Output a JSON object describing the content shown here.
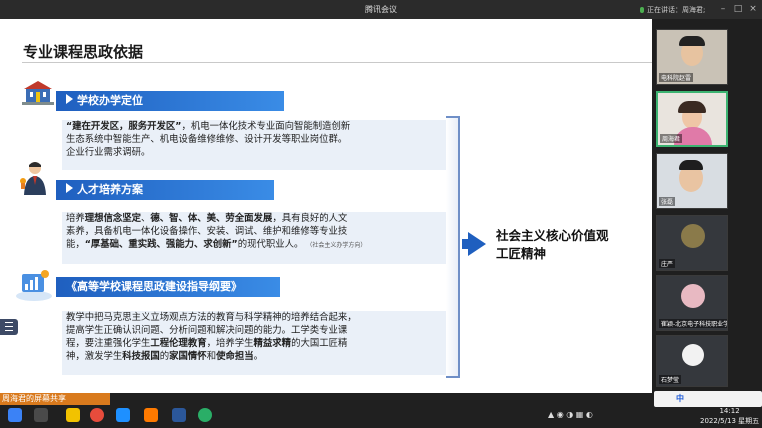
{
  "window": {
    "title": "腾讯会议",
    "speaking": "正在讲话：周海君;"
  },
  "slide": {
    "title": "专业课程思政依据",
    "sections": [
      {
        "heading": "学校办学定位",
        "lines": [
          [
            {
              "t": "“建在开发区，服务开发区”",
              "b": true
            },
            {
              "t": "，机电一体化技术专业面向智能制造创新",
              "b": false
            }
          ],
          [
            {
              "t": "生态系统中智能生产、机电设备维修维修、设计开发等职业岗位群。",
              "b": false
            }
          ],
          [
            {
              "t": "企业行业需求调研。",
              "b": false
            }
          ]
        ]
      },
      {
        "heading": "人才培养方案",
        "lines": [
          [
            {
              "t": "培养",
              "b": false
            },
            {
              "t": "理想信念坚定",
              "b": true
            },
            {
              "t": "、",
              "b": false
            },
            {
              "t": "德、智、体、美、劳全面发展",
              "b": true
            },
            {
              "t": "，具有良好的人文",
              "b": false
            }
          ],
          [
            {
              "t": "素养，具备机电一体化设备操作、安装、调试、维护和维修等专业技",
              "b": false
            }
          ],
          [
            {
              "t": "能，",
              "b": false
            },
            {
              "t": "“厚基础、重实践、强能力、求创新”",
              "b": true
            },
            {
              "t": "的现代职业人。",
              "b": false
            }
          ]
        ],
        "note": "（社会主义办学方向）"
      },
      {
        "heading": "《高等学校课程思政建设指导纲要》",
        "lines": [
          [
            {
              "t": "教学中把马克思主义立场观点方法的教育与科学精神的培养结合起来，",
              "b": false
            }
          ],
          [
            {
              "t": "提高学生正确认识问题、分析问题和解决问题的能力。工学类专业课",
              "b": false
            }
          ],
          [
            {
              "t": "程，要注重强化学生",
              "b": false
            },
            {
              "t": "工程伦理教育",
              "b": true
            },
            {
              "t": "，培养学生",
              "b": false
            },
            {
              "t": "精益求精",
              "b": true
            },
            {
              "t": "的大国工匠精",
              "b": false
            }
          ],
          [
            {
              "t": "神，激发学生",
              "b": false
            },
            {
              "t": "科技报国",
              "b": true
            },
            {
              "t": "的",
              "b": false
            },
            {
              "t": "家国情怀",
              "b": true
            },
            {
              "t": "和",
              "b": false
            },
            {
              "t": "使命担当",
              "b": true
            },
            {
              "t": "。",
              "b": false
            }
          ]
        ]
      }
    ],
    "result": [
      "社会主义核心价值观",
      "工匠精神"
    ]
  },
  "participants": [
    {
      "name": "电科院赵雷",
      "active": false
    },
    {
      "name": "周海君",
      "active": true
    },
    {
      "name": "张磊",
      "active": false
    },
    {
      "name": "庄严",
      "active": false
    },
    {
      "name": "崔颖-北京电子科技职业学院",
      "active": false
    },
    {
      "name": "石梦莹",
      "active": false
    }
  ],
  "share_bar": "周海君的屏幕共享",
  "clock": {
    "time": "14:12",
    "date": "2022/5/13 星期五"
  },
  "ime": "中"
}
